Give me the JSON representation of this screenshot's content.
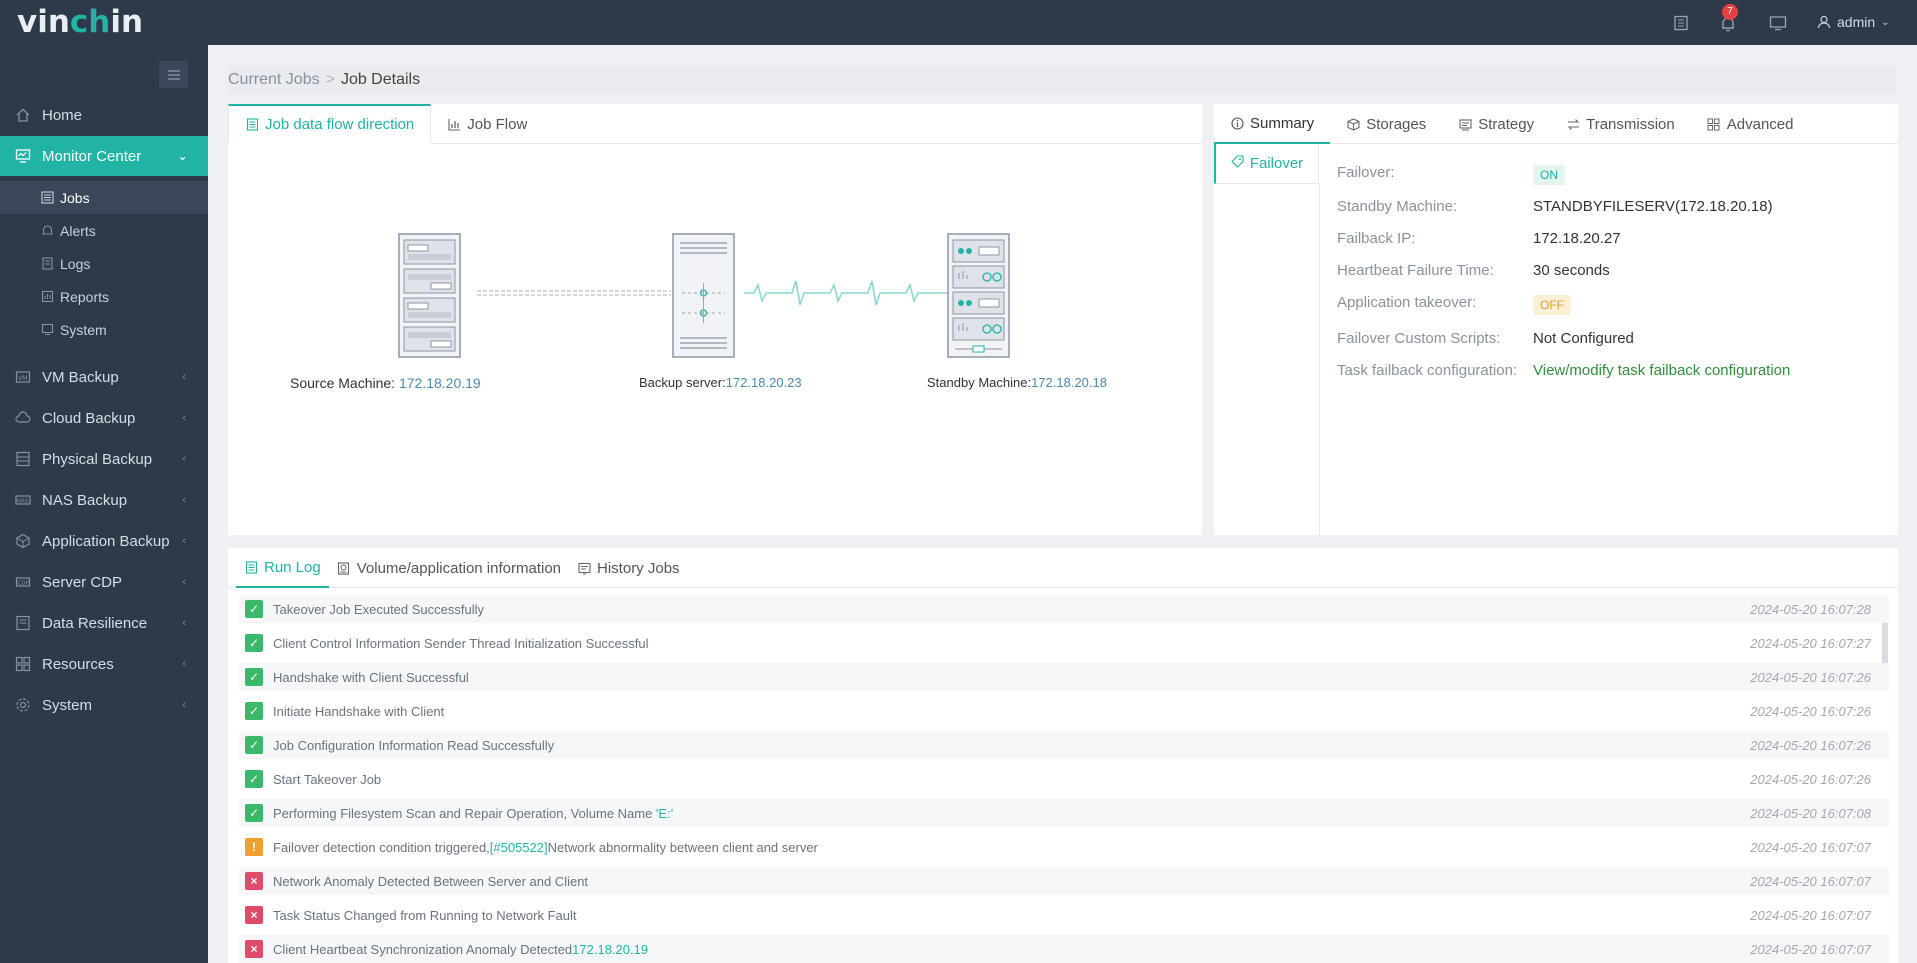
{
  "app": {
    "logo_prefix": "vin",
    "logo_accent": "ch",
    "logo_suffix": "in",
    "notification_count": "7",
    "user": "admin"
  },
  "sidebar": {
    "items": [
      {
        "label": "Home",
        "icon": "home-icon"
      },
      {
        "label": "Monitor Center",
        "icon": "monitor-icon"
      },
      {
        "label": "VM Backup",
        "icon": "vm-icon"
      },
      {
        "label": "Cloud Backup",
        "icon": "cloud-icon"
      },
      {
        "label": "Physical Backup",
        "icon": "physical-icon"
      },
      {
        "label": "NAS Backup",
        "icon": "nas-icon"
      },
      {
        "label": "Application Backup",
        "icon": "app-icon"
      },
      {
        "label": "Server CDP",
        "icon": "cdp-icon"
      },
      {
        "label": "Data Resilience",
        "icon": "resilience-icon"
      },
      {
        "label": "Resources",
        "icon": "resources-icon"
      },
      {
        "label": "System",
        "icon": "system-icon"
      }
    ],
    "sub_items": [
      {
        "label": "Jobs",
        "icon": "jobs-icon"
      },
      {
        "label": "Alerts",
        "icon": "bell-icon"
      },
      {
        "label": "Logs",
        "icon": "logs-icon"
      },
      {
        "label": "Reports",
        "icon": "reports-icon"
      },
      {
        "label": "System",
        "icon": "system-monitor-icon"
      }
    ]
  },
  "breadcrumb": {
    "parent": "Current Jobs",
    "separator": ">",
    "current": "Job Details"
  },
  "flow_panel": {
    "tabs": [
      "Job data flow direction",
      "Job Flow"
    ],
    "source": {
      "label": "Source Machine: ",
      "ip": "172.18.20.19"
    },
    "backup": {
      "label": "Backup server:",
      "ip": "172.18.20.23"
    },
    "standby": {
      "label": "Standby Machine:",
      "ip": "172.18.20.18"
    }
  },
  "summary_panel": {
    "tabs": [
      "Summary",
      "Storages",
      "Strategy",
      "Transmission",
      "Advanced"
    ],
    "side_tab": "Failover",
    "rows": [
      {
        "label": "Failover:",
        "value": "ON"
      },
      {
        "label": "Standby Machine:",
        "value": "STANDBYFILESERV(172.18.20.18)"
      },
      {
        "label": "Failback IP:",
        "value": "172.18.20.27"
      },
      {
        "label": "Heartbeat Failure Time:",
        "value": "30 seconds"
      },
      {
        "label": "Application takeover:",
        "value": "OFF"
      },
      {
        "label": "Failover Custom Scripts:",
        "value": "Not Configured"
      },
      {
        "label": "Task failback configuration:",
        "value": "View/modify task failback configuration"
      }
    ]
  },
  "log_panel": {
    "tabs": [
      "Run Log",
      "Volume/application information",
      "History Jobs"
    ],
    "rows": [
      {
        "status": "ok",
        "text": "Takeover Job Executed Successfully",
        "time": "2024-05-20 16:07:28"
      },
      {
        "status": "ok",
        "text": "Client Control Information Sender Thread Initialization Successful",
        "time": "2024-05-20 16:07:27"
      },
      {
        "status": "ok",
        "text": "Handshake with Client Successful",
        "time": "2024-05-20 16:07:26"
      },
      {
        "status": "ok",
        "text": "Initiate Handshake with Client",
        "time": "2024-05-20 16:07:26"
      },
      {
        "status": "ok",
        "text": "Job Configuration Information Read Successfully",
        "time": "2024-05-20 16:07:26"
      },
      {
        "status": "ok",
        "text": "Start Takeover Job",
        "time": "2024-05-20 16:07:26"
      },
      {
        "status": "ok",
        "text": "Performing Filesystem Scan and Repair Operation, Volume Name ",
        "link": "'E:'",
        "time": "2024-05-20 16:07:08"
      },
      {
        "status": "warn",
        "text": "Failover detection condition triggered,",
        "link": "[#505522]",
        "text2": "Network abnormality between client and server",
        "time": "2024-05-20 16:07:07"
      },
      {
        "status": "err",
        "text": "Network Anomaly Detected Between Server and Client",
        "time": "2024-05-20 16:07:07"
      },
      {
        "status": "err",
        "text": "Task Status Changed from Running to Network Fault",
        "time": "2024-05-20 16:07:07"
      },
      {
        "status": "err",
        "text": "Client Heartbeat Synchronization Anomaly Detected",
        "link": "172.18.20.19",
        "time": "2024-05-20 16:07:07"
      }
    ]
  },
  "colors": {
    "accent": "#21b3a4",
    "sidebar_bg": "#2e3949",
    "ok": "#3bb96b",
    "warn": "#f2a02c",
    "err": "#e14b6a"
  }
}
